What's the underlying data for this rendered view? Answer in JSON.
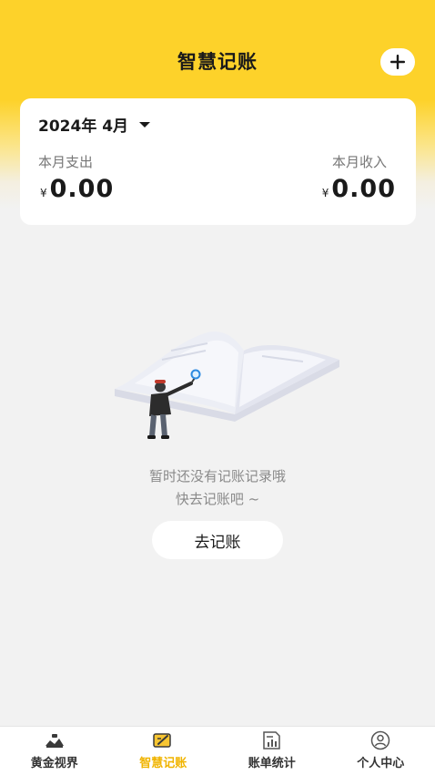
{
  "header": {
    "title": "智慧记账",
    "add_icon": "plus-icon"
  },
  "summary": {
    "month": "2024年 4月",
    "expense_label": "本月支出",
    "expense_currency": "¥",
    "expense_amount": "0.00",
    "income_label": "本月收入",
    "income_currency": "¥",
    "income_amount": "0.00"
  },
  "empty_state": {
    "line1": "暂时还没有记账记录哦",
    "line2": "快去记账吧 ~",
    "button_label": "去记账",
    "illustration_icon": "open-book-illustration"
  },
  "tabbar": {
    "items": [
      {
        "label": "黄金视界",
        "icon": "gold-pile-icon",
        "active": false
      },
      {
        "label": "智慧记账",
        "icon": "ledger-pen-icon",
        "active": true
      },
      {
        "label": "账单统计",
        "icon": "bill-chart-icon",
        "active": false
      },
      {
        "label": "个人中心",
        "icon": "user-circle-icon",
        "active": false
      }
    ]
  },
  "colors": {
    "brand_yellow": "#fdd22a",
    "active_tab": "#f0b400",
    "background": "#f2f2f2"
  }
}
